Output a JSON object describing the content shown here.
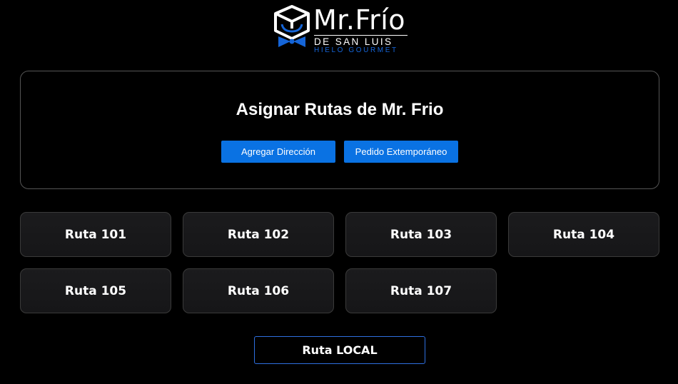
{
  "logo": {
    "name": "Mr.Frío",
    "subtitle": "DE SAN LUIS",
    "tagline": "HIELO GOURMET",
    "accent_color": "#1565d8"
  },
  "panel": {
    "title": "Asignar Rutas de Mr. Frio",
    "add_address_label": "Agregar Dirección",
    "extemporaneous_label": "Pedido Extemporáneo"
  },
  "routes": [
    {
      "label": "Ruta 101"
    },
    {
      "label": "Ruta 102"
    },
    {
      "label": "Ruta 103"
    },
    {
      "label": "Ruta 104"
    },
    {
      "label": "Ruta 105"
    },
    {
      "label": "Ruta 106"
    },
    {
      "label": "Ruta 107"
    }
  ],
  "local_route": {
    "label": "Ruta LOCAL"
  },
  "colors": {
    "background": "#000000",
    "button_blue": "#0a72e3",
    "local_border": "#2e6fe0"
  }
}
